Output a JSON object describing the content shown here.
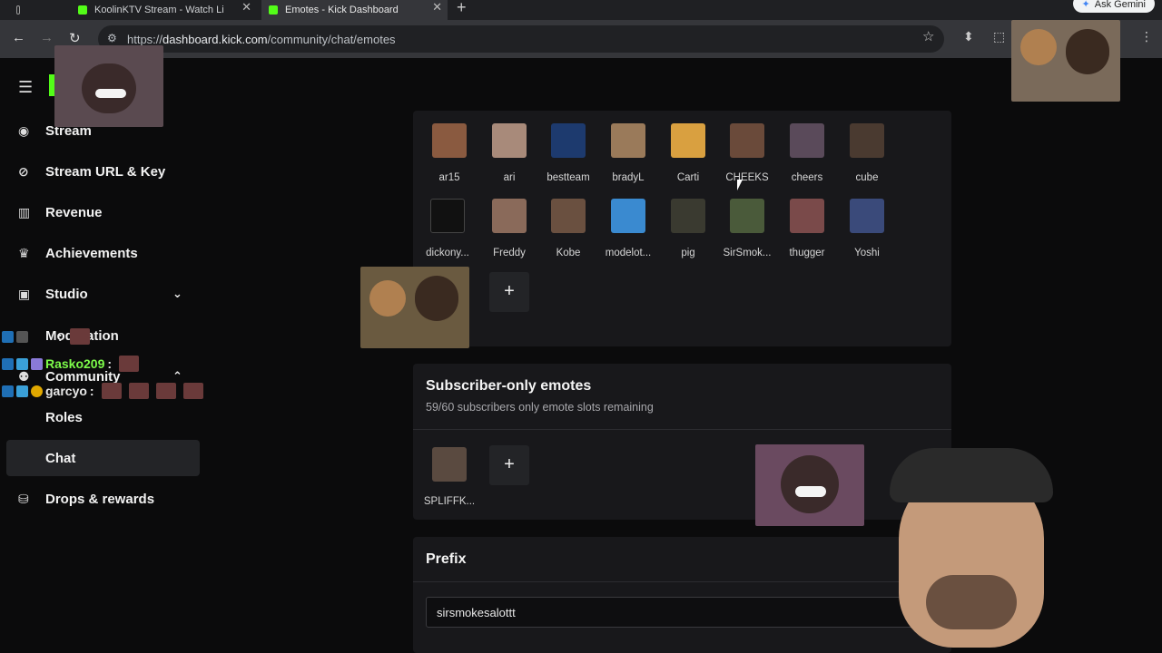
{
  "browser": {
    "tabs": [
      {
        "title": "KoolinKTV Stream - Watch Li"
      },
      {
        "title": "Emotes - Kick Dashboard"
      }
    ],
    "ask_label": "Ask Gemini",
    "url_scheme": "https://",
    "url_host": "dashboard.kick.com",
    "url_path": "/community/chat/emotes"
  },
  "sidebar": {
    "items": [
      {
        "label": "Stream",
        "icon": "stream-icon"
      },
      {
        "label": "Stream URL & Key",
        "icon": "link-icon"
      },
      {
        "label": "Revenue",
        "icon": "chart-icon"
      },
      {
        "label": "Achievements",
        "icon": "trophy-icon"
      },
      {
        "label": "Studio",
        "icon": "studio-icon"
      },
      {
        "label": "Moderation",
        "icon": "wrench-icon"
      },
      {
        "label": "Community",
        "icon": "community-icon"
      },
      {
        "label": "Roles"
      },
      {
        "label": "Chat"
      },
      {
        "label": "Drops & rewards",
        "icon": "drops-icon"
      }
    ]
  },
  "chat_overlay": [
    {
      "user": "Rasko209",
      "sep": ":",
      "color": "#7dfc4a"
    },
    {
      "user": "garcyo",
      "sep": ":",
      "color": "#e8e8e8"
    },
    {
      "sep": ":"
    }
  ],
  "global_emotes": {
    "row1": [
      "ar15",
      "ari",
      "bestteam",
      "bradyL",
      "Carti",
      "CHEEKS",
      "cheers",
      "cube"
    ],
    "row2": [
      "dickony...",
      "Freddy",
      "Kobe",
      "modelot...",
      "pig",
      "SirSmok...",
      "thugger",
      "Yoshi"
    ],
    "add_label": "+"
  },
  "subscriber": {
    "title": "Subscriber-only emotes",
    "subtitle": "59/60 subscribers only emote slots remaining",
    "emotes": [
      "SPLIFFK..."
    ],
    "add_label": "+"
  },
  "prefix": {
    "title": "Prefix",
    "value": "sirsmokesalottt"
  },
  "colors": {
    "accent": "#53fc18",
    "panel": "#18181b",
    "background": "#0b0b0c"
  }
}
